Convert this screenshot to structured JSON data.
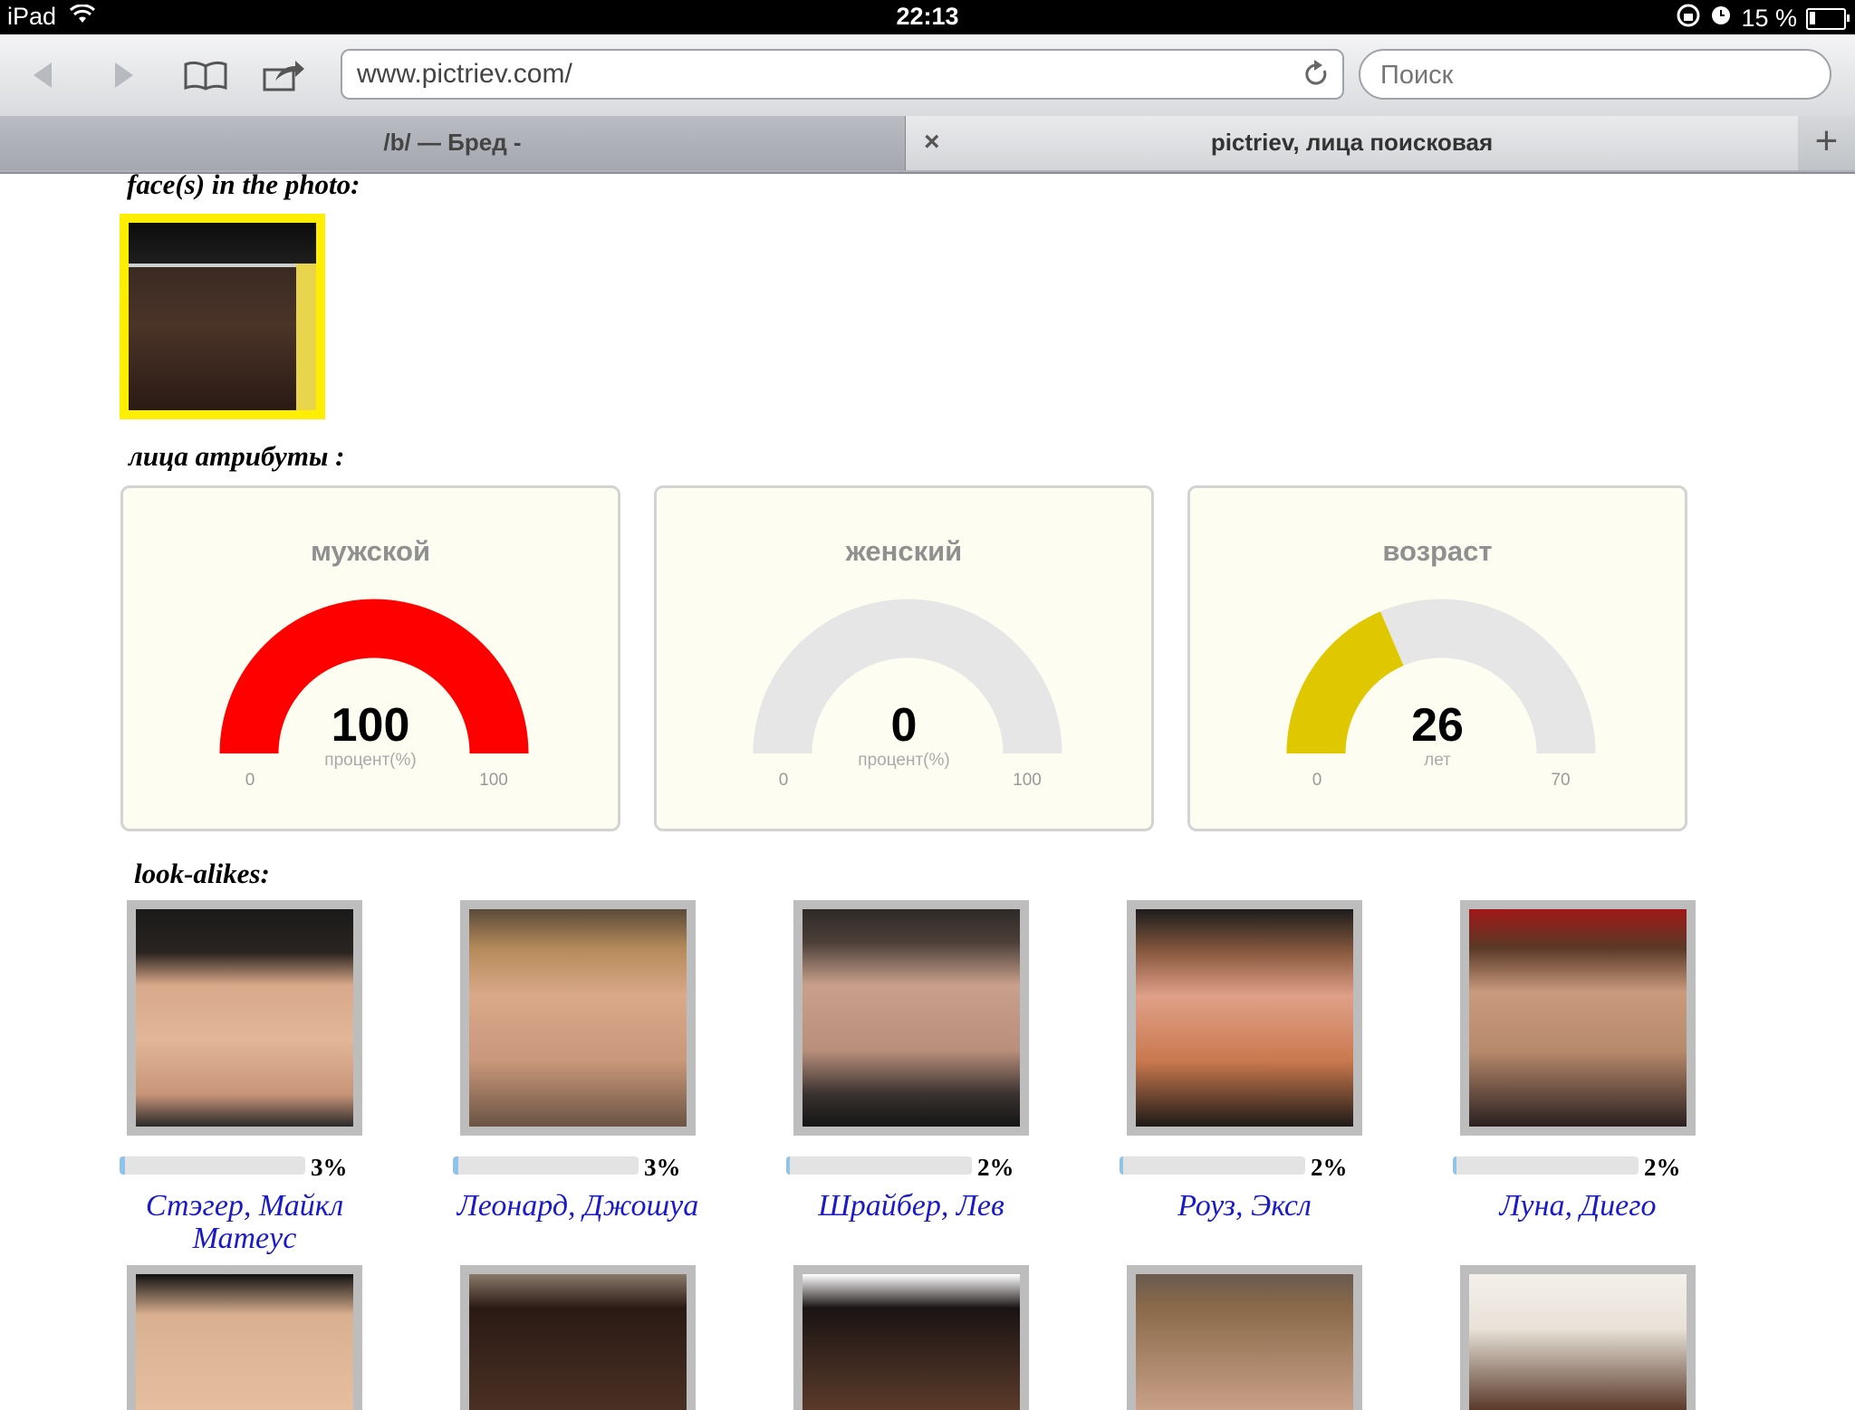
{
  "status": {
    "device": "iPad",
    "time": "22:13",
    "battery": "15 %"
  },
  "browser": {
    "url": "www.pictriev.com/",
    "search_placeholder": "Поиск",
    "tabs": [
      {
        "label": "/b/ — Бред -"
      },
      {
        "label": "pictriev, лица поисковая"
      }
    ],
    "new_tab": "+",
    "close": "×"
  },
  "page": {
    "faces_heading": "face(s) in the photo:",
    "attributes_heading": "лица атрибуты :",
    "lookalikes_heading": "look-alikes:"
  },
  "gauges": [
    {
      "title": "мужской",
      "value": "100",
      "unit": "процент(%)",
      "min": "0",
      "max": "100",
      "fraction": 1.0,
      "color": "#ff0000"
    },
    {
      "title": "женский",
      "value": "0",
      "unit": "процент(%)",
      "min": "0",
      "max": "100",
      "fraction": 0.0,
      "color": "#ff0000"
    },
    {
      "title": "возраст",
      "value": "26",
      "unit": "лет",
      "min": "0",
      "max": "70",
      "fraction": 0.3714,
      "color": "#e0c800"
    }
  ],
  "lookalikes": [
    {
      "name": "Стэгер, Майкл Матеус",
      "percent": "3%",
      "fraction": 0.03
    },
    {
      "name": "Леонард, Джошуа",
      "percent": "3%",
      "fraction": 0.03
    },
    {
      "name": "Шрайбер, Лев",
      "percent": "2%",
      "fraction": 0.02
    },
    {
      "name": "Роуз, Эксл",
      "percent": "2%",
      "fraction": 0.02
    },
    {
      "name": "Луна, Диего",
      "percent": "2%",
      "fraction": 0.02
    }
  ]
}
